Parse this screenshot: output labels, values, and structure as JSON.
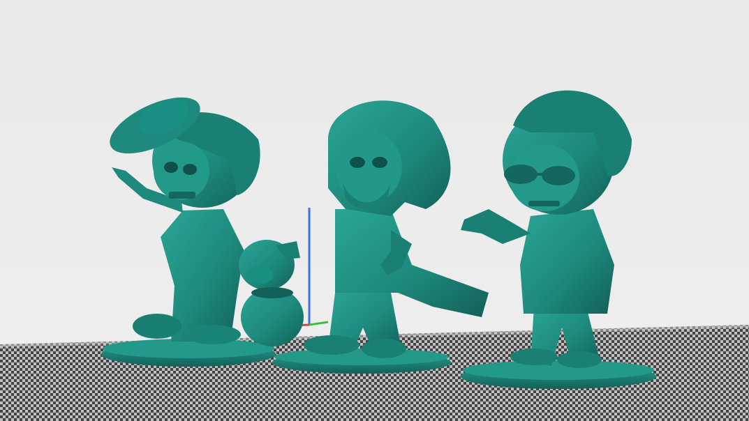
{
  "viewport": {
    "background_color": "#ECECEC",
    "model_color": "#1F8A7E",
    "model_shadow_color": "#125A52",
    "bed_color": "#3A3A3A",
    "bed_grid_color": "#BFBFBF"
  },
  "axes": {
    "x_color": "#E0403A",
    "y_color": "#3FBF3F",
    "z_color": "#3F6FE0"
  },
  "models": [
    {
      "id": "figure-with-hat-and-dog",
      "icon": "skull-figure-icon"
    },
    {
      "id": "figure-with-long-hair",
      "icon": "skull-figure-icon"
    },
    {
      "id": "figure-with-sunglasses",
      "icon": "skull-figure-icon"
    }
  ]
}
